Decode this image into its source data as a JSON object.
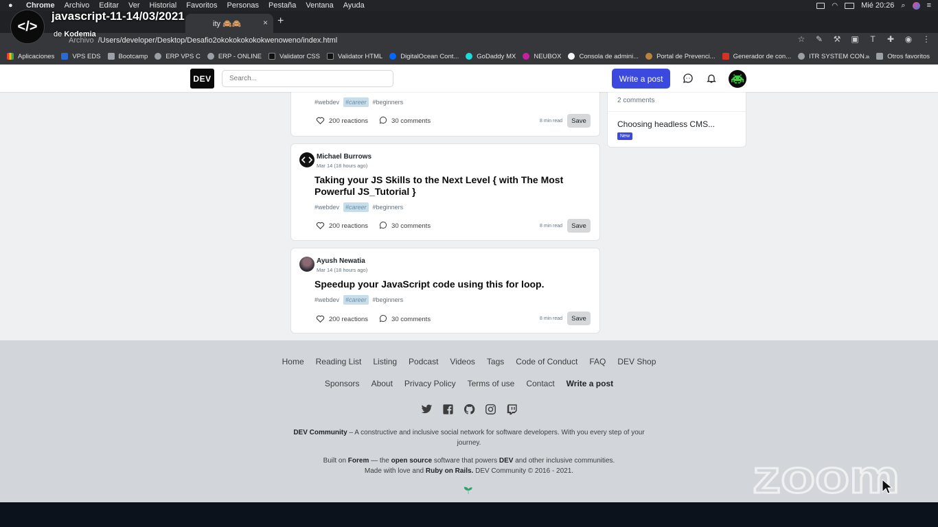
{
  "menubar": {
    "items": [
      "Chrome",
      "Archivo",
      "Editar",
      "Ver",
      "Historial",
      "Favoritos",
      "Personas",
      "Pestaña",
      "Ventana",
      "Ayuda"
    ],
    "clock": "Mié 20:26"
  },
  "meeting": {
    "title": "javascript-11-14/03/2021",
    "by_prefix": "de",
    "by_name": "Kodemia",
    "logo_glyph": "</>"
  },
  "browser": {
    "tab_title": "ity 🙈🙈",
    "tab_close": "×",
    "new_tab": "+",
    "address_scheme": "Archivo",
    "address": "/Users/developer/Desktop/Desafio2okokokokokokwenoweno/index.html"
  },
  "bookmarks": [
    {
      "label": "Aplicaciones",
      "color": "#e94235"
    },
    {
      "label": "VPS EDS",
      "color": "#2a6ad2"
    },
    {
      "label": "Bootcamp",
      "color": "#9aa0a6"
    },
    {
      "label": "ERP VPS C",
      "color": "#9aa0a6"
    },
    {
      "label": "ERP - ONLINE",
      "color": "#9aa0a6"
    },
    {
      "label": "Validator CSS",
      "color": "#111111"
    },
    {
      "label": "Validator HTML",
      "color": "#111111"
    },
    {
      "label": "DigitalOcean Cont...",
      "color": "#0069ff"
    },
    {
      "label": "GoDaddy MX",
      "color": "#1bdbdb"
    },
    {
      "label": "NEUBOX",
      "color": "#c71fa0"
    },
    {
      "label": "Consola de admini...",
      "color": "#f5f5f5"
    },
    {
      "label": "Portal de Prevenci...",
      "color": "#b8843b"
    },
    {
      "label": "Generador de con...",
      "color": "#d93025"
    },
    {
      "label": "ITR SYSTEM CON...",
      "color": "#9aa0a6"
    }
  ],
  "bookmarks_more": "»",
  "bookmarks_others": "Otros favoritos",
  "dev": {
    "logo": "DEV",
    "search_placeholder": "Search...",
    "write_post": "Write a post"
  },
  "sidebar": {
    "comments": "2 comments",
    "item_title": "Choosing headless CMS...",
    "badge": "New"
  },
  "posts": [
    {
      "author": "",
      "date": "",
      "title": "",
      "tags": [
        "#webdev",
        "#career",
        "#beginners"
      ],
      "reactions": "200 reactions",
      "comments": "30 comments",
      "read_time": "8 min read",
      "save": "Save"
    },
    {
      "author": "Michael Burrows",
      "date": "Mar 14 (18 hours ago)",
      "title": "Taking your JS Skills to the Next Level { with The Most Powerful JS_Tutorial }",
      "tags": [
        "#webdev",
        "#career",
        "#beginners"
      ],
      "reactions": "200 reactions",
      "comments": "30 comments",
      "read_time": "8 min read",
      "save": "Save"
    },
    {
      "author": "Ayush Newatia",
      "date": "Mar 14 (18 hours ago)",
      "title": "Speedup your JavaScript code using this for loop.",
      "tags": [
        "#webdev",
        "#career",
        "#beginners"
      ],
      "reactions": "200 reactions",
      "comments": "30 comments",
      "read_time": "8 min read",
      "save": "Save"
    }
  ],
  "footer": {
    "links_row1": [
      "Home",
      "Reading List",
      "Listing",
      "Podcast",
      "Videos",
      "Tags",
      "Code of Conduct",
      "FAQ",
      "DEV Shop"
    ],
    "links_row2": [
      "Sponsors",
      "About",
      "Privacy Policy",
      "Terms of use",
      "Contact",
      "Write a post"
    ],
    "social": [
      "twitter-icon",
      "facebook-icon",
      "github-icon",
      "instagram-icon",
      "twitch-icon"
    ],
    "desc_brand": "DEV Community",
    "desc_line1": " – A constructive and inclusive social network for software developers. With you every step of your",
    "desc_line2": "journey.",
    "built_prefix": "Built on ",
    "built_forem": "Forem",
    "built_mid": " — the ",
    "built_open": "open source",
    "built_mid2": " software that powers ",
    "built_dev": "DEV",
    "built_suffix": " and other inclusive communities.",
    "made_prefix": "Made with love and ",
    "made_rails": "Ruby on Rails.",
    "made_suffix": " DEV Community © 2016 - 2021."
  },
  "zoom_watermark": "zoom",
  "colors": {
    "dev_blue": "#3b49df",
    "footer_bg": "#d2d6db",
    "page_bg": "#eef0f1"
  }
}
